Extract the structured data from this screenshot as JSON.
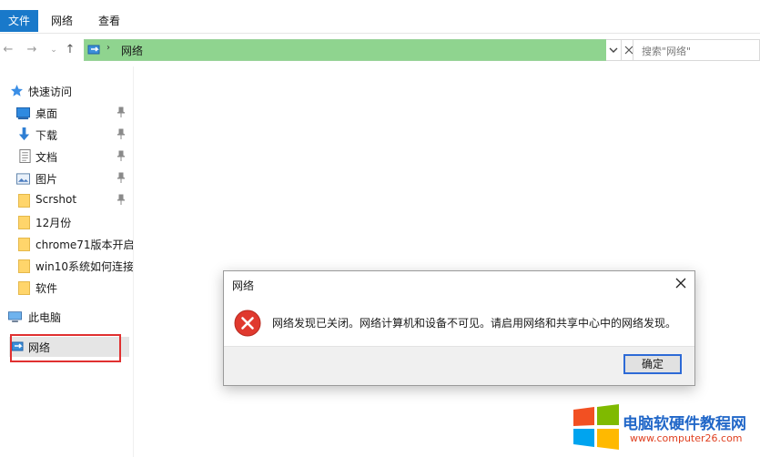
{
  "ribbon": {
    "tabs": [
      "文件",
      "网络",
      "查看"
    ]
  },
  "address": {
    "path": "网络",
    "search_placeholder": "搜索\"网络\""
  },
  "sidebar": {
    "quick_access": "快速访问",
    "items": [
      "桌面",
      "下载",
      "文档",
      "图片",
      "Scrshot",
      "12月份",
      "chrome71版本开启",
      "win10系统如何连接",
      "软件"
    ],
    "this_pc": "此电脑",
    "network": "网络"
  },
  "dialog": {
    "title": "网络",
    "message": "网络发现已关闭。网络计算机和设备不可见。请启用网络和共享中心中的网络发现。",
    "ok_label": "确定"
  },
  "watermark": {
    "title": "电脑软硬件教程网",
    "url": "www.computer26.com"
  },
  "colors": {
    "accent": "#1979ca",
    "address_bar": "#8fd48f",
    "highlight": "#e03030",
    "error": "#e0392e"
  }
}
